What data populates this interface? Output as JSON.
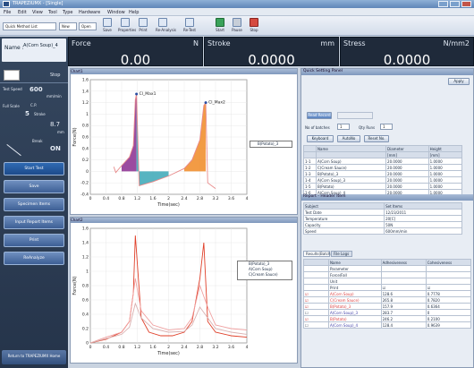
{
  "app": {
    "title": "TRAPEZIUMX - [Single]"
  },
  "menu": [
    "File",
    "Edit",
    "View",
    "Tool",
    "Type",
    "Hardware",
    "Window",
    "Help"
  ],
  "toolbar": {
    "method_select": "Quick Method List",
    "new": "New",
    "open": "Open",
    "save": "Save",
    "properties": "Properties",
    "print": "Print",
    "reanalysis": "Re-Analysis",
    "re_test": "Re-Test",
    "start": "Start",
    "pause": "Pause",
    "stop": "Stop"
  },
  "readouts": [
    {
      "name": "Force",
      "unit": "N",
      "value": "0.00"
    },
    {
      "name": "Stroke",
      "unit": "mm",
      "value": "0.0000"
    },
    {
      "name": "Stress",
      "unit": "N/mm2",
      "value": "0.0000"
    }
  ],
  "left": {
    "name_label": "Name :",
    "name_value": "A(Corn Soup)_4",
    "stop": "Stop",
    "test_speed_label": "Test Speed",
    "test_speed_value": "600",
    "test_speed_unit": "mm/min",
    "full_scale_label": "Full Scale",
    "cp_label": "C.P.",
    "cp_value": "5",
    "stroke_label": "Stroke",
    "x_value": "8.7",
    "x_unit": "mm",
    "break_label": "Break",
    "break_value": "ON",
    "buttons": [
      "Start Test",
      "Save",
      "Specimen Items",
      "Input Report Items",
      "Print",
      "ReAnalyze"
    ],
    "return_label": "Return to TRAPEZIUMX Home"
  },
  "chart1": {
    "title": "Chart1",
    "legend": "B(Potato)_3"
  },
  "chart2": {
    "title": "Chart2",
    "legend": [
      "B(Potato)_3",
      "A(Corn Soup)",
      "C(Cream Sauce)"
    ]
  },
  "chart_data": [
    {
      "type": "line",
      "title": "",
      "xlabel": "Time(sec)",
      "ylabel": "Force(N)",
      "xlim": [
        0,
        4
      ],
      "ylim": [
        -0.4,
        1.6
      ],
      "x_ticks": [
        "0",
        "0.4",
        "0.8",
        "1.2",
        "1.6",
        "2",
        "2.4",
        "2.8",
        "3.2",
        "3.6",
        "4"
      ],
      "y_ticks": [
        "-0.4",
        "-0.2",
        "0",
        "0.2",
        "0.4",
        "0.6",
        "0.8",
        "1",
        "1.2",
        "1.4",
        "1.6"
      ],
      "annotations": [
        "Cl_Max1",
        "Cl_Max2"
      ],
      "series": [
        {
          "name": "B(Potato)_3",
          "x": [
            0.6,
            0.65,
            0.8,
            1.0,
            1.1,
            1.15,
            1.18,
            1.25,
            1.6,
            2.0,
            2.4,
            2.6,
            2.8,
            2.9,
            2.95,
            3.0,
            3.2
          ],
          "y": [
            0.08,
            -0.02,
            0.1,
            0.25,
            0.45,
            1.25,
            1.35,
            -0.25,
            -0.18,
            -0.08,
            0.05,
            0.2,
            0.55,
            1.15,
            1.2,
            -0.2,
            -0.3
          ]
        }
      ]
    },
    {
      "type": "line",
      "title": "",
      "xlabel": "Time(sec)",
      "ylabel": "Force(N)",
      "xlim": [
        0,
        4
      ],
      "ylim": [
        0,
        1.6
      ],
      "x_ticks": [
        "0",
        "0.4",
        "0.8",
        "1.2",
        "1.6",
        "2",
        "2.4",
        "2.8",
        "3.2",
        "3.6",
        "4"
      ],
      "y_ticks": [
        "0",
        "0.2",
        "0.4",
        "0.6",
        "0.8",
        "1",
        "1.2",
        "1.4",
        "1.6"
      ],
      "series": [
        {
          "name": "B(Potato)_3",
          "x": [
            0,
            0.4,
            0.8,
            1.0,
            1.1,
            1.15,
            1.3,
            1.5,
            1.8,
            2.1,
            2.4,
            2.6,
            2.8,
            2.9,
            3.0,
            3.2,
            3.6,
            4.0
          ],
          "y": [
            0,
            0.05,
            0.15,
            0.3,
            0.7,
            1.5,
            0.35,
            0.15,
            0.1,
            0.1,
            0.15,
            0.3,
            0.9,
            1.4,
            0.3,
            0.15,
            0.1,
            0.08
          ]
        },
        {
          "name": "A(Corn Soup)",
          "x": [
            0,
            0.4,
            0.8,
            1.0,
            1.15,
            1.3,
            1.6,
            2.0,
            2.4,
            2.6,
            2.8,
            3.0,
            3.2,
            3.6,
            4.0
          ],
          "y": [
            0,
            0.08,
            0.15,
            0.3,
            0.9,
            0.45,
            0.25,
            0.18,
            0.2,
            0.35,
            0.8,
            0.5,
            0.25,
            0.2,
            0.18
          ]
        },
        {
          "name": "C(Cream Sauce)",
          "x": [
            0,
            0.4,
            0.8,
            1.0,
            1.15,
            1.3,
            1.6,
            2.0,
            2.4,
            2.6,
            2.8,
            3.0,
            3.2,
            3.6,
            4.0
          ],
          "y": [
            0,
            0.06,
            0.12,
            0.22,
            0.55,
            0.35,
            0.2,
            0.15,
            0.16,
            0.25,
            0.5,
            0.35,
            0.2,
            0.15,
            0.12
          ]
        }
      ]
    }
  ],
  "quick_setting": {
    "title": "Quick Setting Panel",
    "apply": "Apply",
    "read_record": "Read Record",
    "no_of_batches_label": "No of batches",
    "no_of_batches_value": "1",
    "qty_runs_label": "Qty Runs",
    "qty_runs_value": "1",
    "btns": [
      "Keyboard",
      "AutoNo",
      "Reset No."
    ],
    "cols": [
      "Name",
      "Diameter",
      "Height"
    ],
    "units": [
      "",
      "[mm]",
      "[mm]"
    ],
    "rows": [
      [
        "1-1",
        "A(Corn Soup)",
        "20.0000",
        "1.0000"
      ],
      [
        "1-2",
        "C(Cream Sauce)",
        "20.0000",
        "1.0000"
      ],
      [
        "1-3",
        "B(Potato)_3",
        "20.0000",
        "1.0000"
      ],
      [
        "1-4",
        "A(Corn Soup)_3",
        "20.0000",
        "1.0000"
      ],
      [
        "1-5",
        "B(Potato)",
        "20.0000",
        "1.0000"
      ],
      [
        "1-6",
        "A(Corn Soup)_4",
        "20.0000",
        "1.0000"
      ]
    ]
  },
  "report": {
    "title": "Report - Header Item",
    "cols": [
      "Subject",
      "Set Items"
    ],
    "rows": [
      [
        "Test Date",
        "12/23/2011"
      ],
      [
        "Temperature",
        "20[C]"
      ],
      [
        "Capacity",
        "50N"
      ],
      [
        "Speed",
        "600mm/min"
      ]
    ]
  },
  "results": {
    "tabs": [
      "Results(Batch)",
      "File Logs"
    ],
    "cols": [
      "Name",
      "Adhesiveness",
      "Cohesiveness"
    ],
    "meta": [
      "Parameter",
      "Force/Fall",
      "Unit"
    ],
    "print_label": "Print",
    "rows": [
      [
        "A(Corn Soup)",
        "128.6",
        "0.7778"
      ],
      [
        "C(Cream Sauce)",
        "265.8",
        "0.7820"
      ],
      [
        "B(Potato)_3",
        "157.9",
        "0.6364"
      ],
      [
        "A(Corn Soup)_3",
        "283.7",
        "0"
      ],
      [
        "B(Potato)",
        "246.2",
        "0.2100"
      ],
      [
        "A(Corn Soup)_4",
        "128.4",
        "0.9639"
      ]
    ]
  },
  "colors": {
    "accent": "#3d5f95",
    "purple": "#8a2c8f",
    "teal": "#3aa7b6",
    "orange": "#f08a24",
    "pink": "#e88a8a",
    "blue": "#2b4ea2"
  }
}
